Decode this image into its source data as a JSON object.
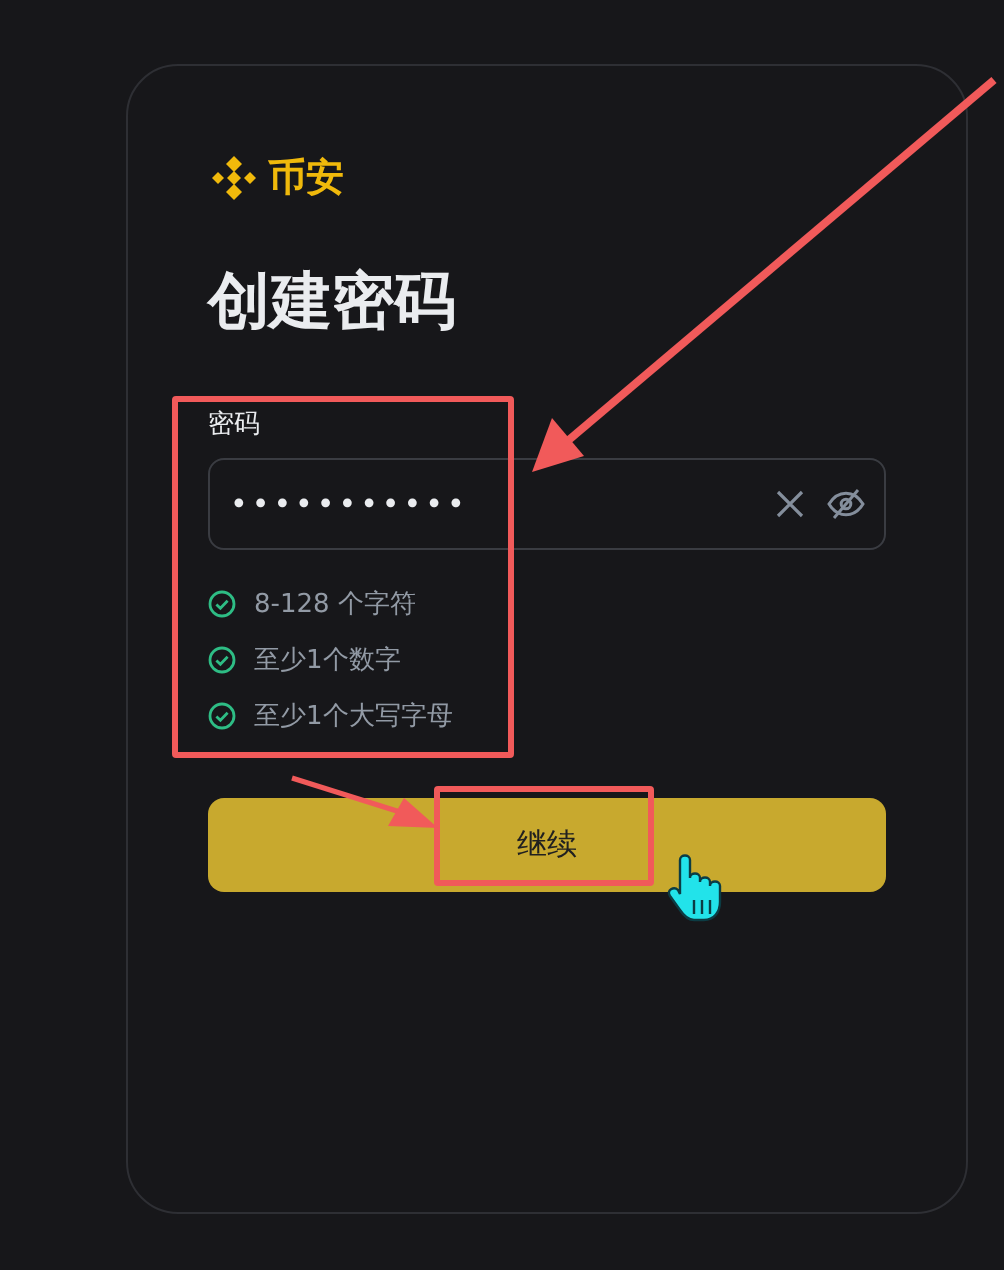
{
  "brand": {
    "name": "币安"
  },
  "title": "创建密码",
  "password": {
    "label": "密码",
    "value": "•••••••••••",
    "masked": true
  },
  "requirements": [
    {
      "text": "8-128 个字符",
      "met": true
    },
    {
      "text": "至少1个数字",
      "met": true
    },
    {
      "text": "至少1个大写字母",
      "met": true
    }
  ],
  "button": {
    "label": "继续"
  }
}
